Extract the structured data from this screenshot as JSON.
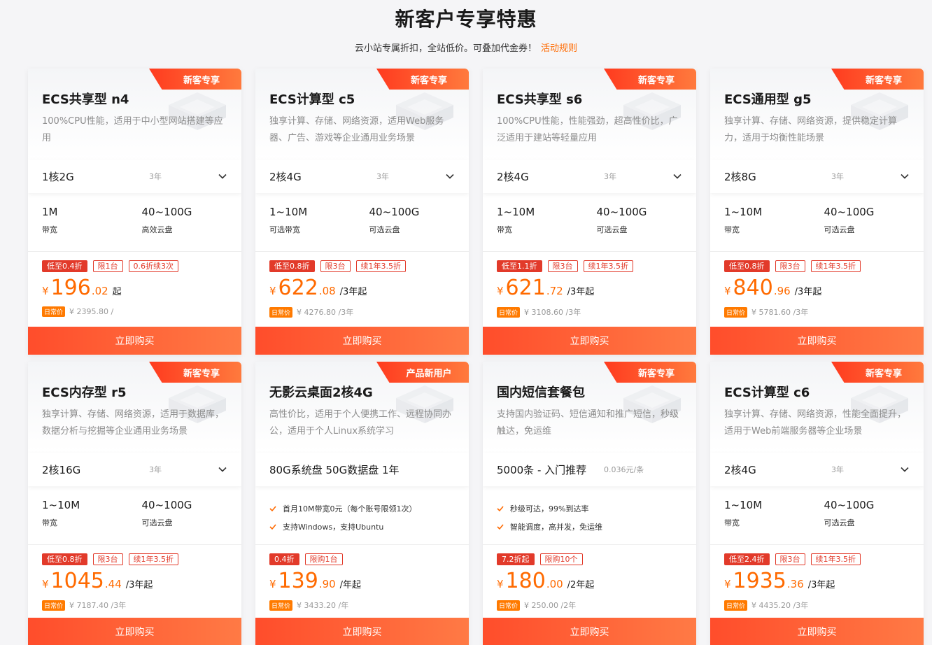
{
  "header": {
    "title": "新客户专享特惠",
    "subtitle": "云小站专属折扣，全站低价。可叠加代金券！",
    "rules_link": "活动规则"
  },
  "colors": {
    "accent": "#ff6a00",
    "tag_red": "#e23a2a",
    "button_start": "#ff4d2b",
    "button_end": "#ff7a45"
  },
  "products": [
    {
      "ribbon": "新客专享",
      "title": "ECS共享型 n4",
      "desc": "100%CPU性能，适用于中小型网站搭建等应用",
      "selector": {
        "value": "1核2G",
        "term": "3年",
        "dropdown": true
      },
      "specs": [
        {
          "value": "1M",
          "label": "带宽"
        },
        {
          "value": "40~100G",
          "label": "高效云盘"
        }
      ],
      "features": [],
      "tags": [
        "低至0.4折",
        "限1台",
        "0.6折续3次"
      ],
      "price": {
        "currency": "¥",
        "int": "196",
        "dec": ".02",
        "unit": "起"
      },
      "original": {
        "badge": "日常价",
        "text": "¥ 2395.80 /"
      },
      "buy_label": "立即购买"
    },
    {
      "ribbon": "新客专享",
      "title": "ECS计算型 c5",
      "desc": "独享计算、存储、网络资源，适用Web服务器、广告、游戏等企业通用业务场景",
      "selector": {
        "value": "2核4G",
        "term": "3年",
        "dropdown": true
      },
      "specs": [
        {
          "value": "1~10M",
          "label": "可选带宽"
        },
        {
          "value": "40~100G",
          "label": "可选云盘"
        }
      ],
      "features": [],
      "tags": [
        "低至0.8折",
        "限3台",
        "续1年3.5折"
      ],
      "price": {
        "currency": "¥",
        "int": "622",
        "dec": ".08",
        "unit": "/3年起"
      },
      "original": {
        "badge": "日常价",
        "text": "¥ 4276.80 /3年"
      },
      "buy_label": "立即购买"
    },
    {
      "ribbon": "新客专享",
      "title": "ECS共享型 s6",
      "desc": "100%CPU性能，性能强劲，超高性价比，广泛适用于建站等轻量应用",
      "selector": {
        "value": "2核4G",
        "term": "3年",
        "dropdown": true
      },
      "specs": [
        {
          "value": "1~10M",
          "label": "带宽"
        },
        {
          "value": "40~100G",
          "label": "可选云盘"
        }
      ],
      "features": [],
      "tags": [
        "低至1.1折",
        "限3台",
        "续1年3.5折"
      ],
      "price": {
        "currency": "¥",
        "int": "621",
        "dec": ".72",
        "unit": "/3年起"
      },
      "original": {
        "badge": "日常价",
        "text": "¥ 3108.60 /3年"
      },
      "buy_label": "立即购买"
    },
    {
      "ribbon": "新客专享",
      "title": "ECS通用型 g5",
      "desc": "独享计算、存储、网络资源，提供稳定计算力，适用于均衡性能场景",
      "selector": {
        "value": "2核8G",
        "term": "3年",
        "dropdown": true
      },
      "specs": [
        {
          "value": "1~10M",
          "label": "带宽"
        },
        {
          "value": "40~100G",
          "label": "可选云盘"
        }
      ],
      "features": [],
      "tags": [
        "低至0.8折",
        "限3台",
        "续1年3.5折"
      ],
      "price": {
        "currency": "¥",
        "int": "840",
        "dec": ".96",
        "unit": "/3年起"
      },
      "original": {
        "badge": "日常价",
        "text": "¥ 5781.60 /3年"
      },
      "buy_label": "立即购买"
    },
    {
      "ribbon": "新客专享",
      "title": "ECS内存型 r5",
      "desc": "独享计算、存储、网络资源，适用于数据库，数据分析与挖掘等企业通用业务场景",
      "selector": {
        "value": "2核16G",
        "term": "3年",
        "dropdown": true
      },
      "specs": [
        {
          "value": "1~10M",
          "label": "带宽"
        },
        {
          "value": "40~100G",
          "label": "可选云盘"
        }
      ],
      "features": [],
      "tags": [
        "低至0.8折",
        "限3台",
        "续1年3.5折"
      ],
      "price": {
        "currency": "¥",
        "int": "1045",
        "dec": ".44",
        "unit": "/3年起"
      },
      "original": {
        "badge": "日常价",
        "text": "¥ 7187.40 /3年"
      },
      "buy_label": "立即购买"
    },
    {
      "ribbon": "产品新用户",
      "title": "无影云桌面2核4G",
      "desc": "高性价比，适用于个人便携工作、远程协同办公，适用于个人Linux系统学习",
      "selector": {
        "value": "80G系统盘 50G数据盘 1年",
        "term": "",
        "dropdown": false
      },
      "specs": [],
      "features": [
        "首月10M带宽0元（每个账号限领1次）",
        "支持Windows，支持Ubuntu"
      ],
      "tags": [
        "0.4折",
        "限购1台"
      ],
      "price": {
        "currency": "¥",
        "int": "139",
        "dec": ".90",
        "unit": "/年起"
      },
      "original": {
        "badge": "日常价",
        "text": "¥ 3433.20 /年"
      },
      "buy_label": "立即购买"
    },
    {
      "ribbon": "新客专享",
      "title": "国内短信套餐包",
      "desc": "支持国内验证码、短信通知和推广短信，秒级触达，免运维",
      "selector": {
        "value": "5000条 - 入门推荐",
        "term": "0.036元/条",
        "dropdown": false
      },
      "specs": [],
      "features": [
        "秒级可达，99%到达率",
        "智能调度，高并发，免运维"
      ],
      "tags": [
        "7.2折起",
        "限购10个"
      ],
      "price": {
        "currency": "¥",
        "int": "180",
        "dec": ".00",
        "unit": "/2年起"
      },
      "original": {
        "badge": "日常价",
        "text": "¥ 250.00 /2年"
      },
      "buy_label": "立即购买"
    },
    {
      "ribbon": "新客专享",
      "title": "ECS计算型 c6",
      "desc": "独享计算、存储、网络资源，性能全面提升，适用于Web前端服务器等企业场景",
      "selector": {
        "value": "2核4G",
        "term": "3年",
        "dropdown": true
      },
      "specs": [
        {
          "value": "1~10M",
          "label": "带宽"
        },
        {
          "value": "40~100G",
          "label": "可选云盘"
        }
      ],
      "features": [],
      "tags": [
        "低至2.4折",
        "限3台",
        "续1年3.5折"
      ],
      "price": {
        "currency": "¥",
        "int": "1935",
        "dec": ".36",
        "unit": "/3年起"
      },
      "original": {
        "badge": "日常价",
        "text": "¥ 4435.20 /3年"
      },
      "buy_label": "立即购买"
    }
  ]
}
